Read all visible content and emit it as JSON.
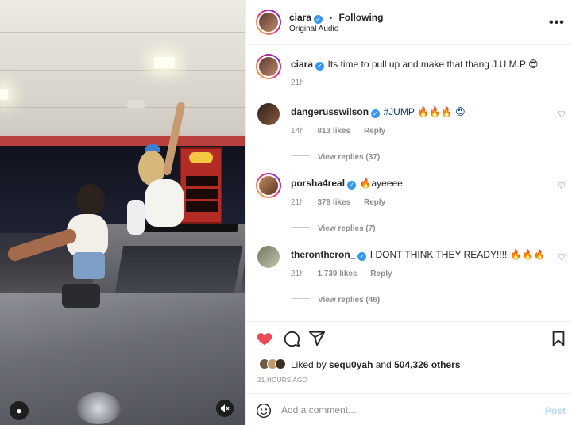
{
  "header": {
    "username": "ciara",
    "separator": "•",
    "follow_status": "Following",
    "audio_label": "Original Audio",
    "more_icon": "more-horizontal-icon"
  },
  "caption": {
    "username": "ciara",
    "text": "Its time to pull up and make that thang J.U.M.P 😎",
    "time": "21h"
  },
  "comments": [
    {
      "username": "dangerusswilson",
      "text": "#JUMP 🔥🔥🔥 😍",
      "time": "14h",
      "likes": "813 likes",
      "reply": "Reply",
      "view_replies": "View replies (37)",
      "verified": true
    },
    {
      "username": "porsha4real",
      "text": "🔥ayeeee",
      "time": "21h",
      "likes": "379 likes",
      "reply": "Reply",
      "view_replies": "View replies (7)",
      "verified": true
    },
    {
      "username": "therontheron_",
      "text": "I DONT THINK THEY READY!!!! 🔥🔥🔥",
      "time": "21h",
      "likes": "1,739 likes",
      "reply": "Reply",
      "view_replies": "View replies (46)",
      "verified": true
    }
  ],
  "actions": {
    "liked": true,
    "icons": [
      "heart-icon",
      "comment-icon",
      "share-icon",
      "bookmark-icon"
    ]
  },
  "likes": {
    "prefix": "Liked by",
    "user": "sequ0yah",
    "connector": "and",
    "others": "504,326 others"
  },
  "timestamp": "21 HOURS AGO",
  "comment_box": {
    "placeholder": "Add a comment...",
    "post_label": "Post"
  },
  "colors": {
    "liked_heart": "#ed4956",
    "verified": "#3897f0",
    "post_disabled": "#b3dbff"
  }
}
